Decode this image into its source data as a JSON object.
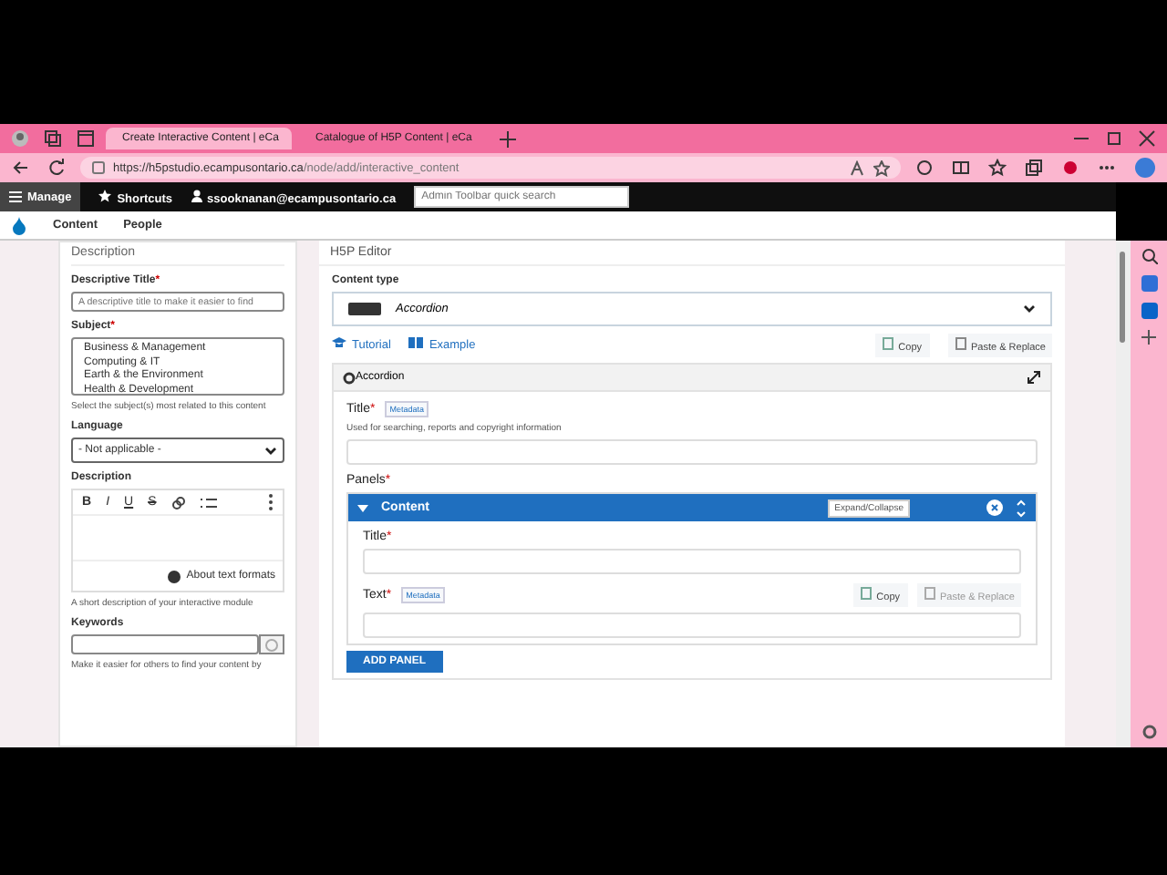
{
  "browser": {
    "tabs": [
      {
        "label": "Create Interactive Content | eCa",
        "selected": true
      },
      {
        "label": "Catalogue of H5P Content | eCa",
        "selected": false
      }
    ],
    "url_host": "https://h5pstudio.ecampusontario.ca",
    "url_path": "/node/add/interactive_content"
  },
  "admin_toolbar": {
    "manage": "Manage",
    "shortcuts": "Shortcuts",
    "user": "ssooknanan@ecampusontario.ca",
    "search_placeholder": "Admin Toolbar quick search"
  },
  "secondary_toolbar": {
    "items": [
      "Content",
      "People"
    ]
  },
  "left_panel": {
    "title": "Description",
    "descriptive_title": {
      "label": "Descriptive Title",
      "required_mark": "*",
      "placeholder": "A descriptive title to make it easier to find"
    },
    "subject": {
      "label": "Subject",
      "required_mark": "*",
      "options": [
        "Business & Management",
        "Computing & IT",
        "Earth & the Environment",
        "Health & Development"
      ],
      "hint": "Select the subject(s) most related to this content"
    },
    "language": {
      "label": "Language",
      "value": "- Not applicable -"
    },
    "description": {
      "label": "Description",
      "tools": [
        "B",
        "I",
        "U",
        "S"
      ],
      "formats_link": "About text formats",
      "hint": "A short description of your interactive module"
    },
    "keywords": {
      "label": "Keywords",
      "hint": "Make it easier for others to find your content by"
    }
  },
  "editor": {
    "title": "H5P Editor",
    "content_type_label": "Content type",
    "content_type": "Accordion",
    "links": [
      "Tutorial",
      "Example"
    ],
    "copy": "Copy",
    "paste": "Paste & Replace",
    "section": "Accordion",
    "title_label": "Title",
    "required_mark": "*",
    "metadata": "Metadata",
    "title_help": "Used for searching, reports and copyright information",
    "panels_label": "Panels",
    "panels_required_mark": "*",
    "panel": {
      "name": "Content",
      "expanded": true,
      "required_mark": "*",
      "tooltip": "Expand/Collapse",
      "title_label": "Title",
      "text_label": "Text",
      "metadata": "Metadata",
      "copy": "Copy",
      "paste": "Paste & Replace"
    },
    "add_panel": "ADD PANEL"
  }
}
